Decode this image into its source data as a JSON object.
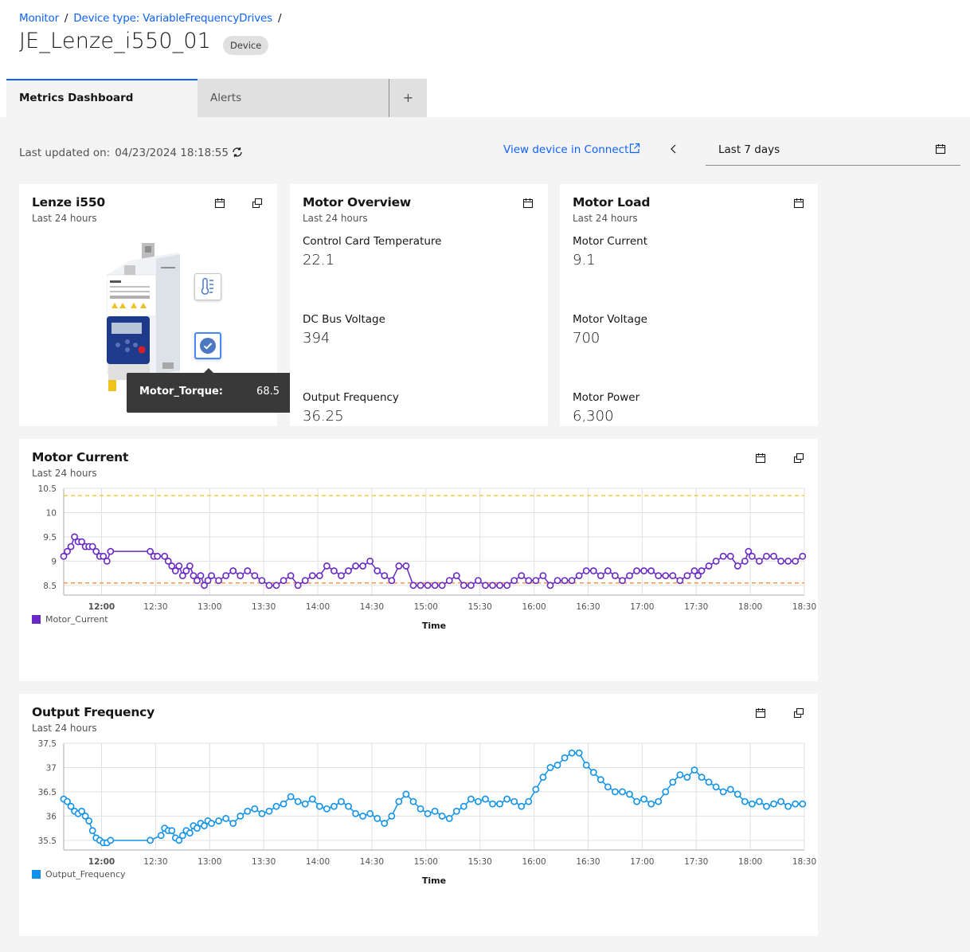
{
  "breadcrumb": {
    "items": [
      "Monitor",
      "Device type: VariableFrequencyDrives"
    ],
    "separator": "/"
  },
  "page": {
    "title": "JE_Lenze_i550_01",
    "type_tag": "Device"
  },
  "tabs": [
    {
      "label": "Metrics Dashboard",
      "active": true
    },
    {
      "label": "Alerts",
      "active": false
    },
    {
      "label": "+",
      "active": false
    }
  ],
  "toolbar": {
    "updated_label": "Last updated on:",
    "updated_value": "04/23/2024 18:18:55",
    "connect_link": "View device in Connect",
    "date_range": "Last 7 days"
  },
  "cards": {
    "device": {
      "title": "Lenze i550",
      "subtitle": "Last 24 hours",
      "hotspots": [
        {
          "icon": "thermometer-icon",
          "selected": false
        },
        {
          "icon": "checkmark-filled-icon",
          "selected": true
        }
      ],
      "tooltip": {
        "key": "Motor_Torque:",
        "value": "68.5"
      }
    },
    "motor_overview": {
      "title": "Motor Overview",
      "subtitle": "Last 24 hours",
      "metrics": [
        {
          "label": "Control Card Temperature",
          "value": "22.1"
        },
        {
          "label": "DC Bus Voltage",
          "value": "394"
        },
        {
          "label": "Output Frequency",
          "value": "36.25"
        }
      ]
    },
    "motor_load": {
      "title": "Motor Load",
      "subtitle": "Last 24 hours",
      "metrics": [
        {
          "label": "Motor Current",
          "value": "9.1"
        },
        {
          "label": "Motor Voltage",
          "value": "700"
        },
        {
          "label": "Motor Power",
          "value": "6,300"
        }
      ]
    }
  },
  "colors": {
    "accent": "#0f62fe",
    "motor_current": "#6929c4",
    "output_frequency": "#1192e8",
    "threshold_upper": "#f1c21b",
    "threshold_lower": "#ff832b"
  },
  "chart_data": [
    {
      "type": "line",
      "title": "Motor Current",
      "subtitle": "Last 24 hours",
      "xlabel": "Time",
      "ylabel": "",
      "ylim": [
        8.3,
        10.5
      ],
      "xlim": [
        "11:39",
        "18:30"
      ],
      "x_ticks": [
        "12:00",
        "12:30",
        "13:00",
        "13:30",
        "14:00",
        "14:30",
        "15:00",
        "15:30",
        "16:00",
        "16:30",
        "17:00",
        "17:30",
        "18:00",
        "18:30"
      ],
      "y_ticks": [
        10.5,
        10,
        9.5,
        9,
        8.5
      ],
      "grid": true,
      "legend": "bottom-left",
      "thresholds": [
        {
          "value": 10.35,
          "color": "#f1c21b"
        },
        {
          "value": 8.55,
          "color": "#ff832b"
        }
      ],
      "series": [
        {
          "name": "Motor_Current",
          "color": "#6929c4",
          "x": [
            "11:39",
            "11:41",
            "11:43",
            "11:45",
            "11:47",
            "11:49",
            "11:51",
            "11:53",
            "11:55",
            "11:57",
            "11:59",
            "12:01",
            "12:03",
            "12:05",
            "12:27",
            "12:29",
            "12:31",
            "12:35",
            "12:37",
            "12:39",
            "12:41",
            "12:43",
            "12:45",
            "12:47",
            "12:49",
            "12:51",
            "12:53",
            "12:55",
            "12:57",
            "12:59",
            "13:01",
            "13:05",
            "13:09",
            "13:13",
            "13:17",
            "13:21",
            "13:25",
            "13:29",
            "13:33",
            "13:37",
            "13:41",
            "13:45",
            "13:49",
            "13:53",
            "13:57",
            "14:01",
            "14:05",
            "14:09",
            "14:13",
            "14:17",
            "14:21",
            "14:25",
            "14:29",
            "14:33",
            "14:37",
            "14:41",
            "14:45",
            "14:49",
            "14:53",
            "14:57",
            "15:01",
            "15:05",
            "15:09",
            "15:13",
            "15:17",
            "15:21",
            "15:25",
            "15:29",
            "15:33",
            "15:37",
            "15:41",
            "15:45",
            "15:49",
            "15:53",
            "15:57",
            "16:01",
            "16:05",
            "16:09",
            "16:13",
            "16:17",
            "16:21",
            "16:25",
            "16:29",
            "16:33",
            "16:37",
            "16:41",
            "16:45",
            "16:49",
            "16:53",
            "16:57",
            "17:01",
            "17:05",
            "17:09",
            "17:13",
            "17:17",
            "17:21",
            "17:25",
            "17:29",
            "17:31",
            "17:33",
            "17:37",
            "17:41",
            "17:45",
            "17:49",
            "17:53",
            "17:57",
            "17:59",
            "18:01",
            "18:05",
            "18:09",
            "18:13",
            "18:17",
            "18:21",
            "18:25",
            "18:29"
          ],
          "values": [
            9.1,
            9.2,
            9.3,
            9.5,
            9.4,
            9.4,
            9.3,
            9.3,
            9.3,
            9.2,
            9.1,
            9.1,
            9.0,
            9.2,
            9.2,
            9.1,
            9.1,
            9.1,
            9.0,
            8.9,
            8.8,
            8.9,
            8.7,
            8.8,
            8.9,
            8.7,
            8.6,
            8.7,
            8.5,
            8.6,
            8.7,
            8.6,
            8.7,
            8.8,
            8.7,
            8.8,
            8.7,
            8.6,
            8.5,
            8.5,
            8.6,
            8.7,
            8.5,
            8.6,
            8.7,
            8.7,
            8.9,
            8.8,
            8.7,
            8.8,
            8.9,
            8.9,
            9.0,
            8.8,
            8.7,
            8.6,
            8.9,
            8.9,
            8.5,
            8.5,
            8.5,
            8.5,
            8.5,
            8.6,
            8.7,
            8.5,
            8.5,
            8.6,
            8.5,
            8.5,
            8.5,
            8.5,
            8.6,
            8.7,
            8.6,
            8.6,
            8.7,
            8.5,
            8.6,
            8.6,
            8.6,
            8.7,
            8.8,
            8.8,
            8.7,
            8.8,
            8.7,
            8.6,
            8.7,
            8.8,
            8.8,
            8.8,
            8.7,
            8.7,
            8.7,
            8.6,
            8.7,
            8.8,
            8.7,
            8.8,
            8.9,
            9.0,
            9.1,
            9.1,
            8.9,
            9.0,
            9.2,
            9.1,
            9.0,
            9.1,
            9.1,
            9.0,
            9.0,
            9.0,
            9.1
          ]
        }
      ]
    },
    {
      "type": "line",
      "title": "Output Frequency",
      "subtitle": "Last 24 hours",
      "xlabel": "Time",
      "ylabel": "",
      "ylim": [
        35.3,
        37.5
      ],
      "xlim": [
        "11:39",
        "18:30"
      ],
      "x_ticks": [
        "12:00",
        "12:30",
        "13:00",
        "13:30",
        "14:00",
        "14:30",
        "15:00",
        "15:30",
        "16:00",
        "16:30",
        "17:00",
        "17:30",
        "18:00",
        "18:30"
      ],
      "y_ticks": [
        37.5,
        37,
        36.5,
        36,
        35.5
      ],
      "grid": true,
      "legend": "bottom-left",
      "series": [
        {
          "name": "Output_Frequency",
          "color": "#1192e8",
          "x": [
            "11:39",
            "11:41",
            "11:43",
            "11:45",
            "11:47",
            "11:49",
            "11:51",
            "11:53",
            "11:55",
            "11:57",
            "11:59",
            "12:01",
            "12:03",
            "12:05",
            "12:27",
            "12:33",
            "12:35",
            "12:37",
            "12:39",
            "12:41",
            "12:43",
            "12:45",
            "12:47",
            "12:49",
            "12:51",
            "12:53",
            "12:55",
            "12:57",
            "12:59",
            "13:01",
            "13:05",
            "13:09",
            "13:13",
            "13:17",
            "13:21",
            "13:25",
            "13:29",
            "13:33",
            "13:37",
            "13:41",
            "13:45",
            "13:49",
            "13:53",
            "13:57",
            "14:01",
            "14:05",
            "14:09",
            "14:13",
            "14:17",
            "14:21",
            "14:25",
            "14:29",
            "14:33",
            "14:37",
            "14:41",
            "14:45",
            "14:49",
            "14:53",
            "14:57",
            "15:01",
            "15:05",
            "15:09",
            "15:13",
            "15:17",
            "15:21",
            "15:25",
            "15:29",
            "15:33",
            "15:37",
            "15:41",
            "15:45",
            "15:49",
            "15:53",
            "15:57",
            "16:01",
            "16:05",
            "16:09",
            "16:13",
            "16:17",
            "16:21",
            "16:25",
            "16:29",
            "16:33",
            "16:37",
            "16:41",
            "16:45",
            "16:49",
            "16:53",
            "16:57",
            "17:01",
            "17:05",
            "17:09",
            "17:13",
            "17:17",
            "17:21",
            "17:25",
            "17:29",
            "17:33",
            "17:37",
            "17:41",
            "17:45",
            "17:49",
            "17:53",
            "17:57",
            "18:01",
            "18:05",
            "18:09",
            "18:13",
            "18:17",
            "18:21",
            "18:25",
            "18:29"
          ],
          "values": [
            36.35,
            36.3,
            36.2,
            36.1,
            36.05,
            36.1,
            36.0,
            35.9,
            35.7,
            35.55,
            35.5,
            35.45,
            35.45,
            35.5,
            35.5,
            35.6,
            35.75,
            35.7,
            35.7,
            35.55,
            35.5,
            35.6,
            35.7,
            35.65,
            35.8,
            35.75,
            35.85,
            35.8,
            35.9,
            35.85,
            35.9,
            35.95,
            35.85,
            36.0,
            36.1,
            36.15,
            36.05,
            36.1,
            36.2,
            36.25,
            36.4,
            36.3,
            36.25,
            36.35,
            36.2,
            36.15,
            36.2,
            36.3,
            36.2,
            36.05,
            36.0,
            36.05,
            35.95,
            35.85,
            36.0,
            36.3,
            36.45,
            36.3,
            36.15,
            36.05,
            36.1,
            36.0,
            35.95,
            36.1,
            36.2,
            36.35,
            36.3,
            36.35,
            36.25,
            36.25,
            36.35,
            36.3,
            36.2,
            36.3,
            36.55,
            36.8,
            37.0,
            37.05,
            37.2,
            37.3,
            37.3,
            37.05,
            36.9,
            36.75,
            36.6,
            36.5,
            36.5,
            36.45,
            36.3,
            36.35,
            36.25,
            36.3,
            36.5,
            36.7,
            36.85,
            36.8,
            36.95,
            36.8,
            36.7,
            36.6,
            36.5,
            36.55,
            36.45,
            36.3,
            36.25,
            36.3,
            36.2,
            36.25,
            36.3,
            36.2,
            36.25,
            36.25
          ]
        }
      ]
    }
  ]
}
